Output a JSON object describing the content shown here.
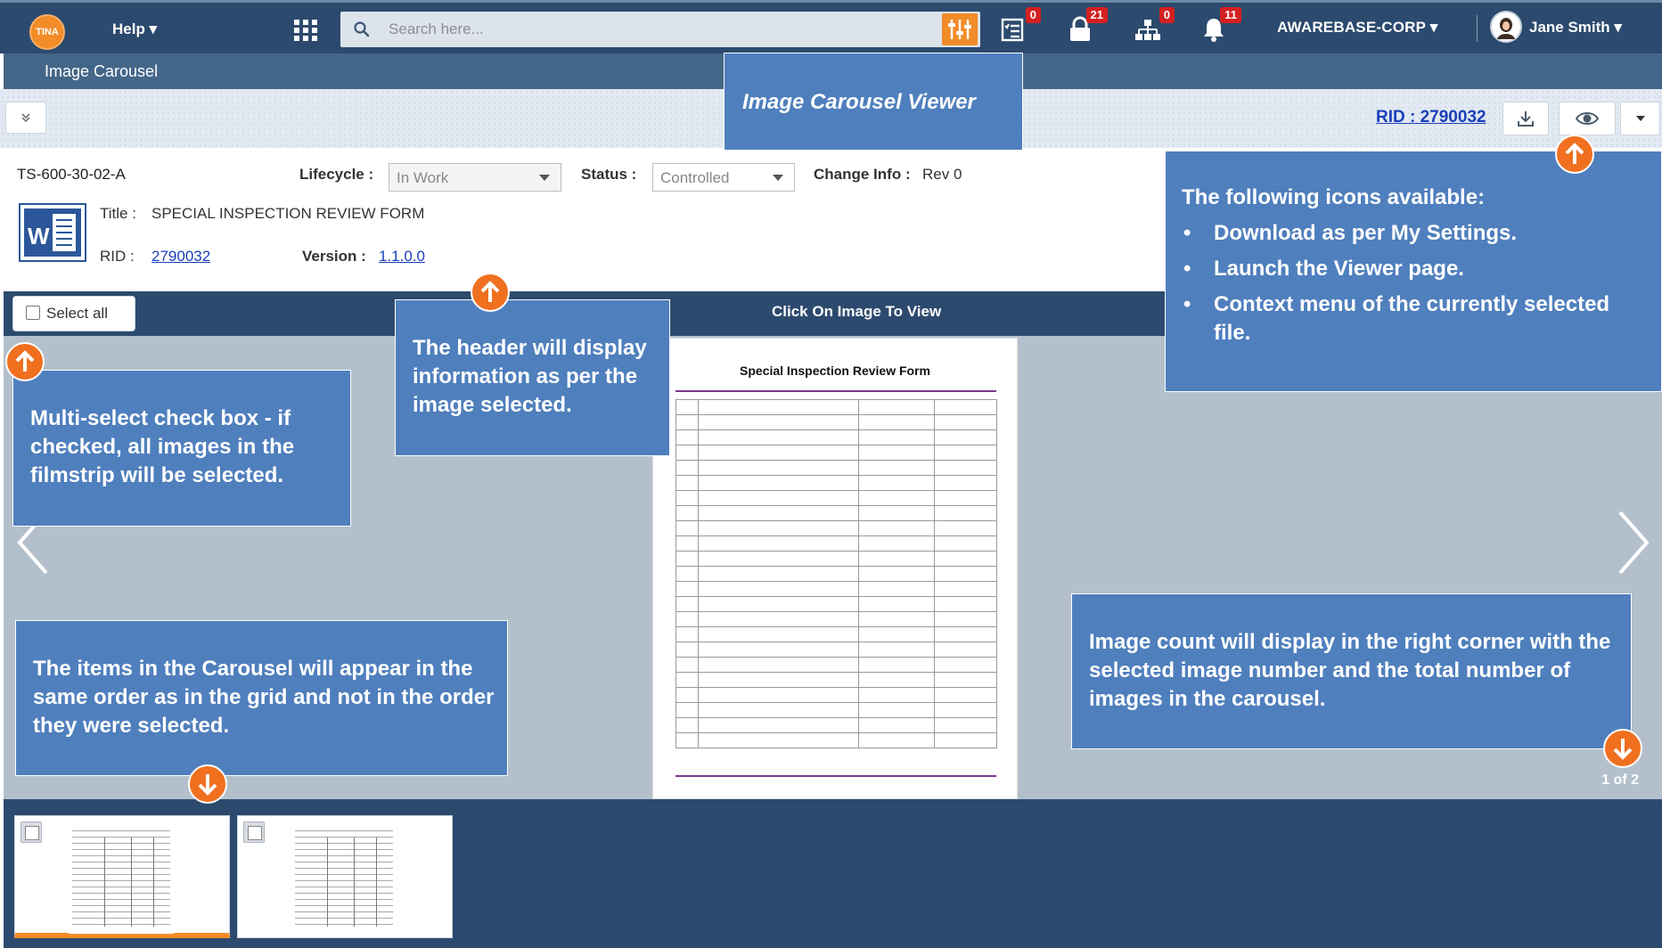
{
  "app": {
    "logo_text": "TINA",
    "help_label": "Help ▾"
  },
  "search": {
    "placeholder": "Search here..."
  },
  "nav": {
    "tasks_badge": "0",
    "lock_badge": "21",
    "org_chart_badge": "0",
    "notifications_badge": "11",
    "org_name": "AWAREBASE-CORP ▾",
    "user_name": "Jane Smith ▾"
  },
  "breadcrumb": {
    "title": "Image Carousel"
  },
  "toolbar": {
    "collapse_label": "»",
    "rid_link": "RID : 2790032"
  },
  "header": {
    "doc_id": "TS-600-30-02-A",
    "lifecycle_label": "Lifecycle :",
    "lifecycle_value": "In Work",
    "status_label": "Status :",
    "status_value": "Controlled",
    "change_info_label": "Change Info :",
    "change_info_value": "Rev 0",
    "title_label": "Title :",
    "title_value": "SPECIAL INSPECTION REVIEW FORM",
    "rid_label": "RID :",
    "rid_value": "2790032",
    "version_label": "Version :",
    "version_value": "1.1.0.0"
  },
  "viewer": {
    "select_all_label": "Select all",
    "click_hint": "Click On Image To View",
    "image_count": "1 of 2",
    "document_title": "Special Inspection Review Form"
  },
  "callouts": {
    "viewer_title": "Image Carousel Viewer",
    "icons_heading": "The following icons available:",
    "icons_items": [
      "Download as per My Settings.",
      "Launch the Viewer page.",
      "Context menu of the currently selected file."
    ],
    "header_info": "The header will display information as per the image selected.",
    "multiselect": "Multi-select check box - if checked, all images in the filmstrip will be selected.",
    "order": "The items in the Carousel will appear in the same order as in the grid and not in the order they were selected.",
    "count": "Image count will display in the right corner with the selected image number and the total number of images in the carousel."
  },
  "colors": {
    "nav_bg": "#2c4a6e",
    "accent_orange": "#f28c28",
    "callout_blue": "#4f7fbd",
    "link_blue": "#1a3fb8",
    "badge_red": "#d42020"
  },
  "icons": [
    "apps-grid-icon",
    "search-icon",
    "filter-icon",
    "tasks-icon",
    "lock-icon",
    "org-chart-icon",
    "bell-icon",
    "user-avatar-icon",
    "download-icon",
    "eye-icon",
    "caret-down-icon",
    "word-file-icon",
    "chevron-left-icon",
    "chevron-right-icon",
    "arrow-up-icon",
    "arrow-down-icon"
  ]
}
